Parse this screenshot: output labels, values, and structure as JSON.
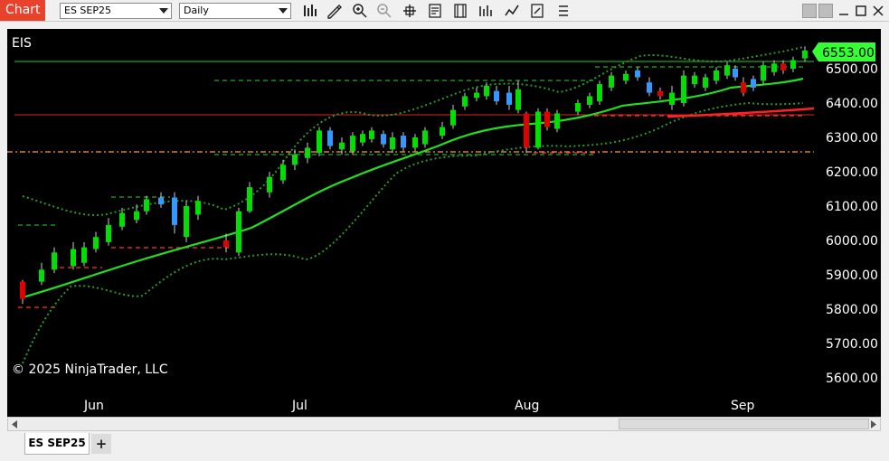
{
  "window": {
    "app_label": "Chart"
  },
  "toolbar": {
    "instrument": "ES SEP25",
    "interval": "Daily",
    "tools": [
      "bar-type-icon",
      "drawing-tool-icon",
      "zoom-in-icon",
      "zoom-out-icon",
      "crosshair-icon",
      "properties-icon",
      "data-box-icon",
      "indicators-icon",
      "strategies-icon",
      "snapshot-icon",
      "more-icon"
    ]
  },
  "chart": {
    "symbol": "EIS",
    "copyright": "© 2025 NinjaTrader, LLC",
    "last_price": "6553.00",
    "price_labels": [
      "6500.00",
      "6400.00",
      "6300.00",
      "6200.00",
      "6100.00",
      "6000.00",
      "5900.00",
      "5800.00",
      "5700.00",
      "5600.00"
    ],
    "month_labels": [
      "Jun",
      "Jul",
      "Aug",
      "Sep"
    ],
    "colors": {
      "up": "#00e000",
      "down": "#e00000",
      "up_blue": "#3399ff",
      "sma": "#22dd22",
      "bands": "#2a9a2a",
      "accent": "#66ff66"
    }
  },
  "tabs": {
    "active": "ES SEP25",
    "add": "+"
  }
}
